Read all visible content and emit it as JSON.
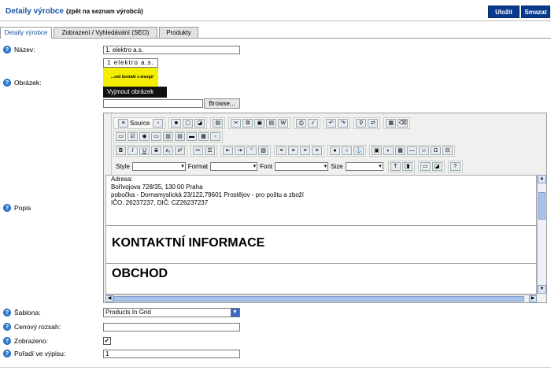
{
  "header": {
    "title": "Detaily výrobce",
    "back_link": "(zpět na seznam výrobců)",
    "save_label": "Uložit",
    "delete_label": "Smazat"
  },
  "tabs": [
    {
      "label": "Detaily výrobce",
      "active": true
    },
    {
      "label": "Zobrazení / Vyhledávání (SEO)",
      "active": false
    },
    {
      "label": "Produkty",
      "active": false
    }
  ],
  "fields": {
    "name": {
      "label": "Název:",
      "value": "1. elektro a.s."
    },
    "image": {
      "label": "Obrázek:",
      "logo_text_top": "1 elektro a.s.",
      "logo_text_bottom": "...váš kontakt s energií",
      "cut_button": "Vyjmout obrázek",
      "file_value": "",
      "browse_label": "Browse..."
    },
    "description": {
      "label": "Popis"
    },
    "template": {
      "label": "Šablona:",
      "value": "Products In Grid"
    },
    "price_range": {
      "label": "Cenový rozsah:",
      "value": ""
    },
    "displayed": {
      "label": "Zobrazeno:",
      "checked": true,
      "check_mark": "✓"
    },
    "order": {
      "label": "Pořadí ve výpisu:",
      "value": "1"
    }
  },
  "editor": {
    "source_label": "Source",
    "style_label": "Style",
    "format_label": "Format",
    "font_label": "Font",
    "size_label": "Size",
    "content_lines": [
      "Adresa:",
      "Bořivojova 728/35, 130 00 Praha",
      "pobočka - Dornamyslická 23/122,79601 Prostějov - pro poštu a zboží",
      "IČO: 26237237,  DIČ: CZ26237237"
    ],
    "heading1": "KONTAKTNÍ INFORMACE",
    "heading2": "OBCHOD"
  },
  "colors": {
    "title": "#1b57a3",
    "button_bg": "#0a3a8c",
    "help_icon": "#2f7fd0",
    "logo_bg": "#f4ee00"
  }
}
